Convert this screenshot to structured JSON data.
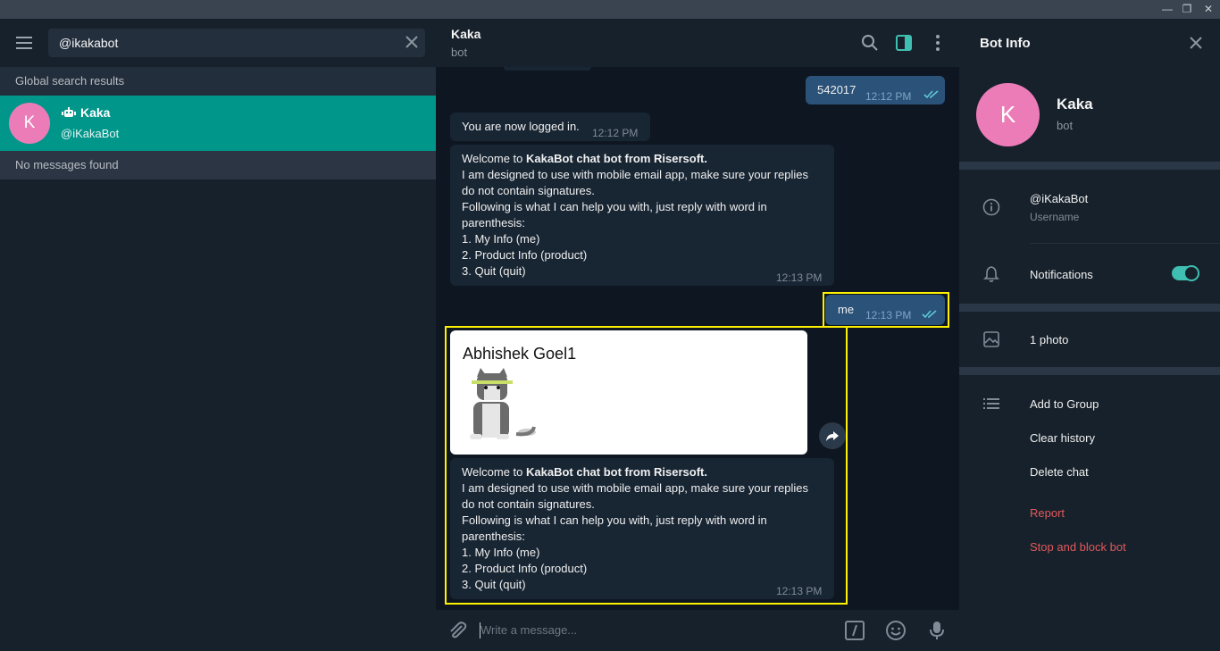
{
  "window": {
    "minimize_icon": "minimize-icon",
    "restore_icon": "restore-icon",
    "close_icon": "close-icon"
  },
  "search": {
    "value": "@ikakabot"
  },
  "sidebar": {
    "global_label": "Global search results",
    "result": {
      "avatar_letter": "K",
      "name": "Kaka",
      "username": "@iKakaBot"
    },
    "no_messages": "No messages found"
  },
  "chat": {
    "title": "Kaka",
    "subtitle": "bot",
    "messages": [
      {
        "text": "542017",
        "time": "12:12 PM"
      },
      {
        "text": "You are now logged in.",
        "time": "12:12 PM"
      },
      {
        "welcome_prefix": "Welcome to ",
        "welcome_bold": "KakaBot chat bot from Risersoft.",
        "line2": "I am designed to use with mobile email app, make sure your replies",
        "line3": "do not contain signatures.",
        "line4": "Following is what I can help you with, just reply with word in",
        "line5": "parenthesis:",
        "line6": "1. My Info (me)",
        "line7": "2. Product Info (product)",
        "line8": "3. Quit (quit)",
        "time": "12:13 PM"
      },
      {
        "text": "me",
        "time": "12:13 PM"
      },
      {
        "card_title": "Abhishek Goel1"
      },
      {
        "welcome_prefix": "Welcome to ",
        "welcome_bold": "KakaBot chat bot from Risersoft.",
        "line2": "I am designed to use with mobile email app, make sure your replies",
        "line3": "do not contain signatures.",
        "line4": "Following is what I can help you with, just reply with word in",
        "line5": "parenthesis:",
        "line6": "1. My Info (me)",
        "line7": "2. Product Info (product)",
        "line8": "3. Quit (quit)",
        "time": "12:13 PM"
      }
    ],
    "composer_placeholder": "Write a message..."
  },
  "panel": {
    "title": "Bot Info",
    "avatar_letter": "K",
    "name": "Kaka",
    "subtitle": "bot",
    "username_value": "@iKakaBot",
    "username_label": "Username",
    "notifications_label": "Notifications",
    "notifications_on": true,
    "photos_label": "1 photo",
    "add_to_group": "Add to Group",
    "clear_history": "Clear history",
    "delete_chat": "Delete chat",
    "report": "Report",
    "stop_block": "Stop and block bot"
  },
  "colors": {
    "accent": "#00968a",
    "avatar": "#ec7cb7",
    "highlight": "#fff200",
    "danger": "#e0595d",
    "toggle": "#3fbfb1"
  }
}
